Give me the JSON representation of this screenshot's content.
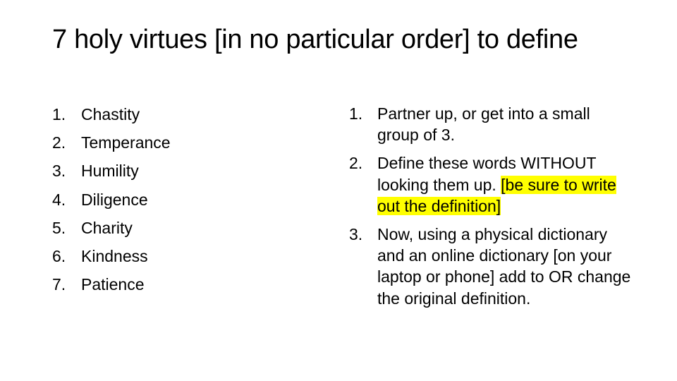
{
  "slide": {
    "title": "7 holy virtues [in no particular order] to define",
    "virtues": [
      {
        "number": "1.",
        "label": "Chastity"
      },
      {
        "number": "2.",
        "label": "Temperance"
      },
      {
        "number": "3.",
        "label": "Humility"
      },
      {
        "number": "4.",
        "label": "Diligence"
      },
      {
        "number": "5.",
        "label": "Charity"
      },
      {
        "number": "6.",
        "label": "Kindness"
      },
      {
        "number": "7.",
        "label": "Patience"
      }
    ],
    "instructions": [
      {
        "number": "1.",
        "text": "Partner up, or get into a small group of 3."
      },
      {
        "number": "2.",
        "text": "Define these words WITHOUT looking them up. ",
        "highlight": "[be sure to write out the definition]"
      },
      {
        "number": "3.",
        "text": "Now, using a physical dictionary and an online dictionary [on your laptop or phone] add to OR change the original definition."
      }
    ],
    "highlight_color": "#ffff00"
  }
}
